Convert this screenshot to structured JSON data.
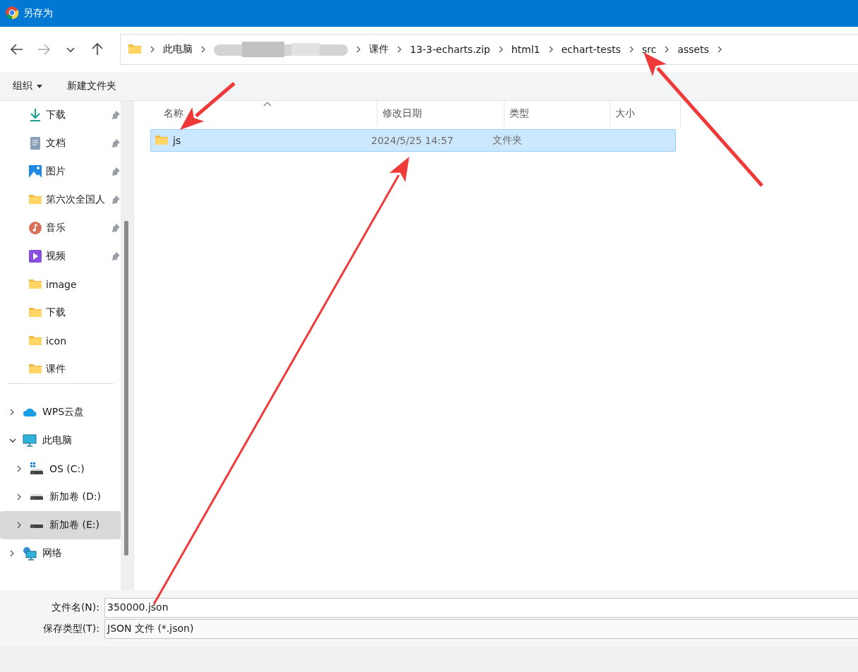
{
  "window": {
    "title": "另存为"
  },
  "nav": {
    "back": {
      "disabled": false
    },
    "forward": {
      "disabled": true
    }
  },
  "breadcrumb": [
    {
      "kind": "crumb",
      "label": "此电脑"
    },
    {
      "kind": "redacted"
    },
    {
      "kind": "crumb",
      "label": "课件"
    },
    {
      "kind": "crumb",
      "label": "13-3-echarts.zip"
    },
    {
      "kind": "crumb",
      "label": "html1"
    },
    {
      "kind": "crumb",
      "label": "echart-tests"
    },
    {
      "kind": "crumb",
      "label": "src"
    },
    {
      "kind": "crumb",
      "label": "assets"
    }
  ],
  "toolbar": {
    "organize": "组织",
    "new_folder": "新建文件夹"
  },
  "sidebar": {
    "quick_access": [
      {
        "kind": "download",
        "label": "下载",
        "pinned": true
      },
      {
        "kind": "document",
        "label": "文档",
        "pinned": true
      },
      {
        "kind": "pictures",
        "label": "图片",
        "pinned": true
      },
      {
        "kind": "folder",
        "label": "第六次全国人",
        "pinned": true
      },
      {
        "kind": "music",
        "label": "音乐",
        "pinned": true
      },
      {
        "kind": "video",
        "label": "视频",
        "pinned": true
      },
      {
        "kind": "folder",
        "label": "image",
        "pinned": false
      },
      {
        "kind": "folder",
        "label": "下载",
        "pinned": false
      },
      {
        "kind": "folder",
        "label": "icon",
        "pinned": false
      },
      {
        "kind": "folder",
        "label": "课件",
        "pinned": false
      }
    ],
    "tree": [
      {
        "kind": "cloud",
        "label": "WPS云盘",
        "expanded": false,
        "selected": false
      },
      {
        "kind": "computer",
        "label": "此电脑",
        "expanded": true,
        "selected": false,
        "children": [
          {
            "kind": "drive-os",
            "label": "OS (C:)",
            "expanded": false,
            "selected": false
          },
          {
            "kind": "drive",
            "label": "新加卷 (D:)",
            "expanded": false,
            "selected": false
          },
          {
            "kind": "drive",
            "label": "新加卷 (E:)",
            "expanded": false,
            "selected": true
          }
        ]
      },
      {
        "kind": "network",
        "label": "网络",
        "expanded": false,
        "selected": false
      }
    ]
  },
  "table": {
    "columns": [
      {
        "label": "名称",
        "sorted": true
      },
      {
        "label": "修改日期",
        "sorted": false
      },
      {
        "label": "类型",
        "sorted": false
      },
      {
        "label": "大小",
        "sorted": false
      }
    ],
    "rows": [
      {
        "name": "js",
        "modified": "2024/5/25 14:57",
        "type": "文件夹",
        "selected": true
      }
    ]
  },
  "form": {
    "file_name": {
      "label": "文件名(N):",
      "value": "350000.json"
    },
    "save_type": {
      "label": "保存类型(T):",
      "value": "JSON 文件 (*.json)"
    }
  },
  "annotations": [
    {
      "kind": "arrow"
    },
    {
      "kind": "arrow"
    },
    {
      "kind": "arrow"
    }
  ]
}
